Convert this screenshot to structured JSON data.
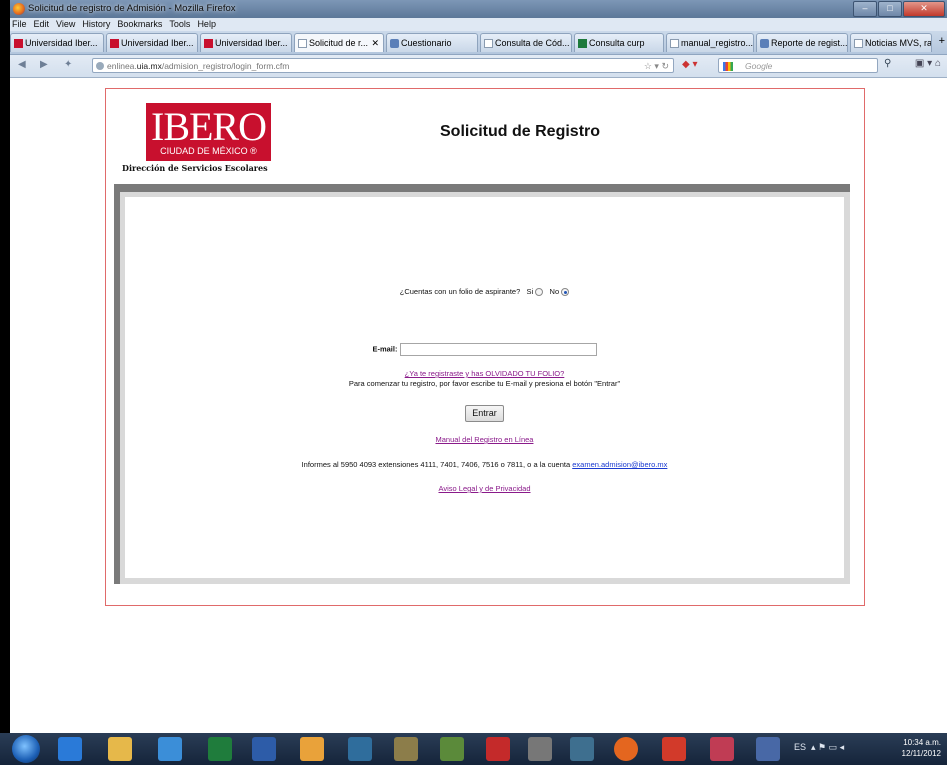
{
  "window": {
    "title": "Solicitud de registro de Admisión - Mozilla Firefox"
  },
  "menu": [
    "File",
    "Edit",
    "View",
    "History",
    "Bookmarks",
    "Tools",
    "Help"
  ],
  "tabs": [
    {
      "label": "Universidad Iber...",
      "icon": "ibero-favicon"
    },
    {
      "label": "Universidad Iber...",
      "icon": "ibero-favicon"
    },
    {
      "label": "Universidad Iber...",
      "icon": "ibero-favicon"
    },
    {
      "label": "Solicitud de r...",
      "icon": "blank-page-icon",
      "active": true
    },
    {
      "label": "Cuestionario",
      "icon": "questionnaire-icon"
    },
    {
      "label": "Consulta de Cód...",
      "icon": "blank-page-icon"
    },
    {
      "label": "Consulta curp",
      "icon": "excel-icon"
    },
    {
      "label": "manual_registro...",
      "icon": "blank-page-icon"
    },
    {
      "label": "Reporte de regist...",
      "icon": "questionnaire-icon"
    },
    {
      "label": "Noticias MVS, ra...",
      "icon": "blank-page-icon"
    }
  ],
  "nav": {
    "url_prefix": "enlinea.",
    "url_domain": "uia.mx",
    "url_path": "/admision_registro/login_form.cfm",
    "search_placeholder": "Google"
  },
  "page": {
    "logo_text": "IBERO",
    "logo_subtext": "CIUDAD DE MÉXICO ®",
    "department": "Dirección de Servicios Escolares",
    "title": "Solicitud de Registro",
    "folio_question": "¿Cuentas con un folio de aspirante?",
    "option_yes": "Si",
    "option_no": "No",
    "email_label": "E-mail:",
    "email_value": "",
    "forgot_link": "¿Ya te registraste y has OLVIDADO TU FOLIO?",
    "instructions": "Para comenzar tu registro, por favor escribe tu E-mail y presiona el botón \"Entrar\"",
    "enter_button": "Entrar",
    "manual_link": "Manual del Registro en Línea",
    "info_text": "Informes al 5950 4093 extensiones 4111, 7401, 7406, 7516 o 7811, o a la cuenta",
    "info_email": "examen.admision@ibero.mx",
    "privacy_link": "Aviso Legal y de Privacidad"
  },
  "taskbar": {
    "language": "ES",
    "time": "10:34 a.m.",
    "date": "12/11/2012"
  },
  "colors": {
    "ibero_red": "#c8102e",
    "frame_border": "#e06a6a",
    "panel_dark": "#7a7a7a",
    "panel_light": "#d9d9d9"
  }
}
